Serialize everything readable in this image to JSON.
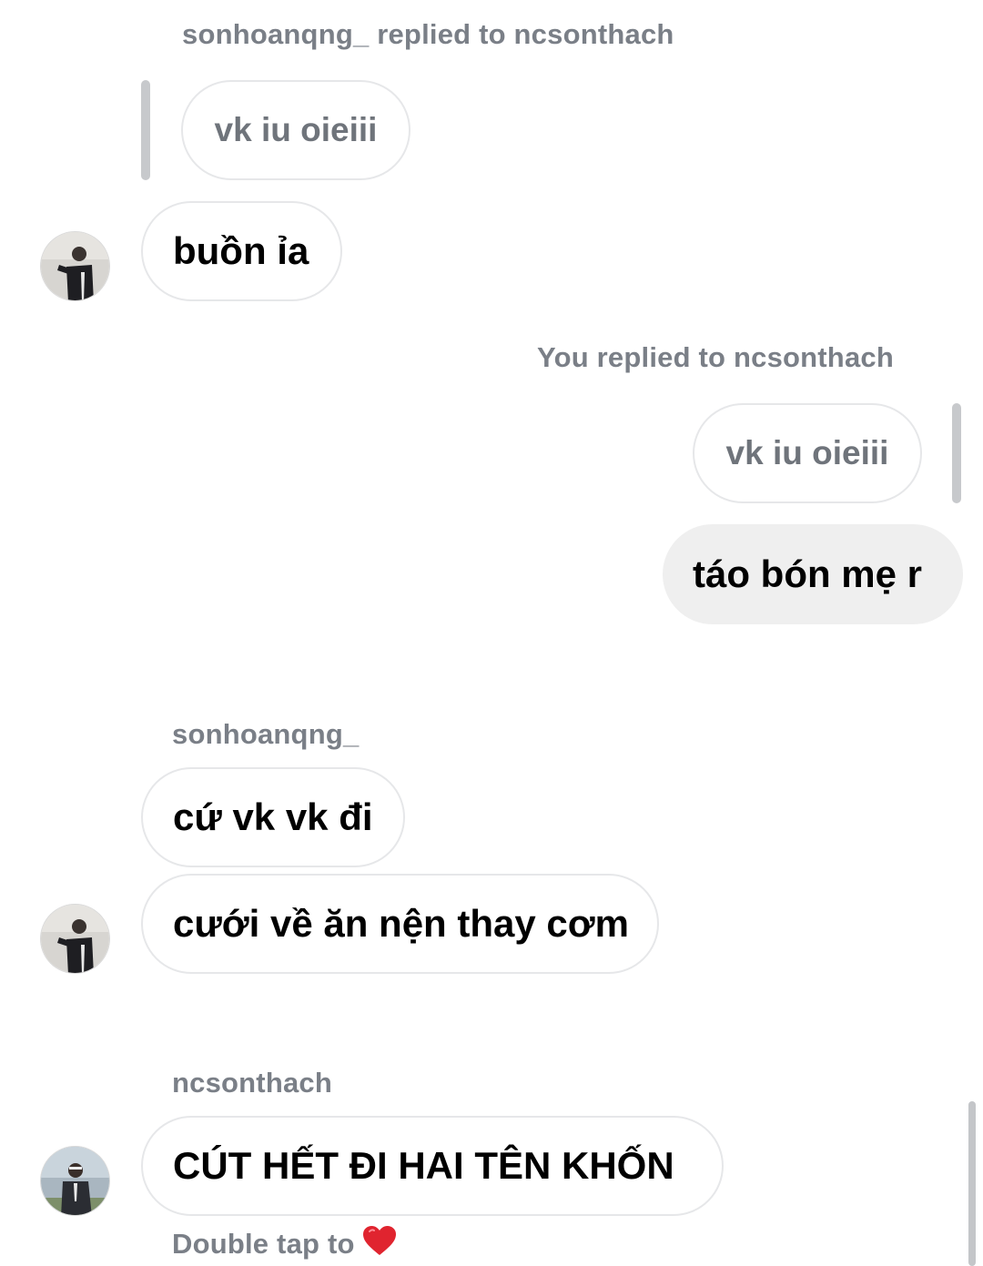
{
  "messages": {
    "reply_meta_1": "sonhoanqng_ replied to ncsonthach",
    "quoted_1": "vk iu oieiii",
    "msg_1": "buồn ỉa",
    "reply_meta_2": "You replied to ncsonthach",
    "quoted_2": "vk iu oieiii",
    "msg_2": "táo bón mẹ r",
    "sender_3": "sonhoanqng_",
    "msg_3a": "cứ vk vk đi",
    "msg_3b": "cưới về ăn nện thay cơm",
    "sender_4": "ncsonthach",
    "msg_4": "CÚT HẾT ĐI HAI TÊN KHỐN",
    "hint": "Double tap to"
  },
  "icons": {
    "heart": "heart-icon",
    "heart_color": "#e0242f"
  },
  "colors": {
    "meta_text": "#7a7f87",
    "bubble_border": "#e6e7e9",
    "my_bubble": "#efefef"
  }
}
